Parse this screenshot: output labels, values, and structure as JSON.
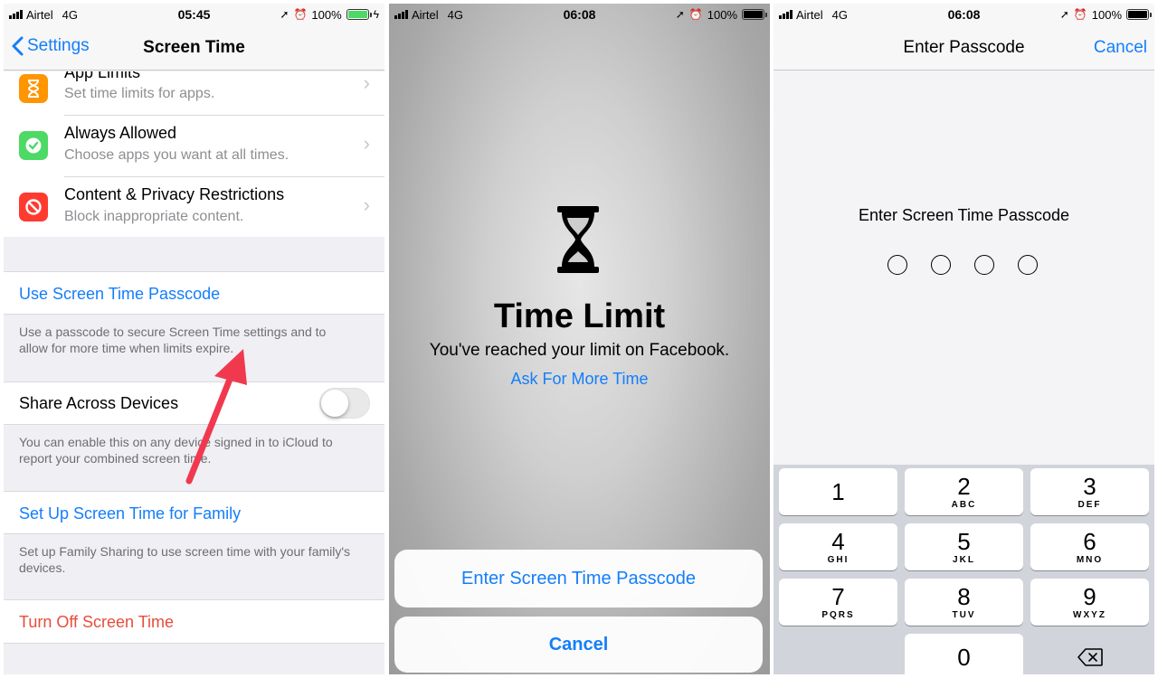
{
  "colors": {
    "accent": "#147efb",
    "destructive": "#e74c3c",
    "battery_green": "#4cd964",
    "arrow": "#f0394f"
  },
  "panel1": {
    "status": {
      "carrier": "Airtel",
      "network": "4G",
      "time": "05:45",
      "battery": "100%"
    },
    "nav": {
      "back_label": "Settings",
      "title": "Screen Time"
    },
    "rows": [
      {
        "title": "App Limits",
        "subtitle": "Set time limits for apps.",
        "icon": "hourglass-icon"
      },
      {
        "title": "Always Allowed",
        "subtitle": "Choose apps you want at all times.",
        "icon": "checkmark-badge-icon"
      },
      {
        "title": "Content & Privacy Restrictions",
        "subtitle": "Block inappropriate content.",
        "icon": "no-entry-icon"
      }
    ],
    "passcode_link": "Use Screen Time Passcode",
    "passcode_note": "Use a passcode to secure Screen Time settings and to allow for more time when limits expire.",
    "share_label": "Share Across Devices",
    "share_note": "You can enable this on any device signed in to iCloud to report your combined screen time.",
    "family_link": "Set Up Screen Time for Family",
    "family_note": "Set up Family Sharing to use screen time with your family's devices.",
    "turn_off": "Turn Off Screen Time"
  },
  "panel2": {
    "status": {
      "carrier": "Airtel",
      "network": "4G",
      "time": "06:08",
      "battery": "100%"
    },
    "title": "Time Limit",
    "message": "You've reached your limit on Facebook.",
    "ask": "Ask For More Time",
    "enter_passcode": "Enter Screen Time Passcode",
    "cancel": "Cancel"
  },
  "panel3": {
    "status": {
      "carrier": "Airtel",
      "network": "4G",
      "time": "06:08",
      "battery": "100%"
    },
    "nav_title": "Enter Passcode",
    "cancel": "Cancel",
    "prompt": "Enter Screen Time Passcode",
    "keys": [
      {
        "num": "1",
        "letters": ""
      },
      {
        "num": "2",
        "letters": "ABC"
      },
      {
        "num": "3",
        "letters": "DEF"
      },
      {
        "num": "4",
        "letters": "GHI"
      },
      {
        "num": "5",
        "letters": "JKL"
      },
      {
        "num": "6",
        "letters": "MNO"
      },
      {
        "num": "7",
        "letters": "PQRS"
      },
      {
        "num": "8",
        "letters": "TUV"
      },
      {
        "num": "9",
        "letters": "WXYZ"
      },
      {
        "num": "0",
        "letters": ""
      }
    ]
  }
}
